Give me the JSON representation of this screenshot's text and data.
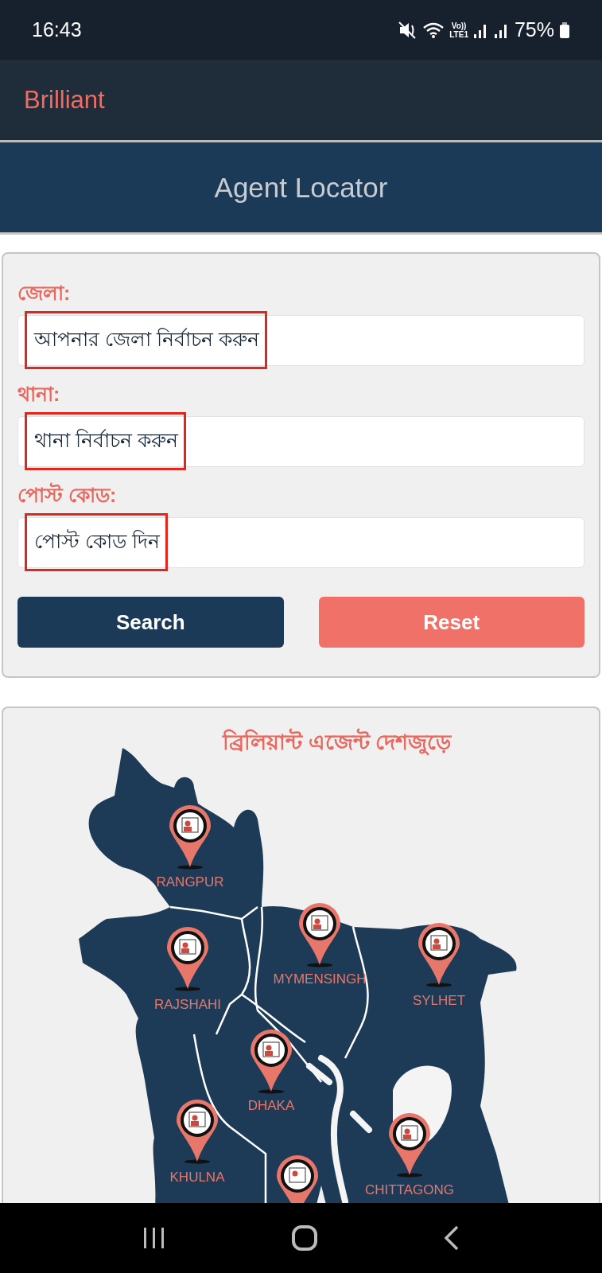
{
  "status_bar": {
    "time": "16:43",
    "volte": [
      "Vo))",
      "LTE1"
    ],
    "battery": "75%"
  },
  "app_bar": {
    "title": "Brilliant"
  },
  "banner": {
    "title": "Agent Locator"
  },
  "form": {
    "fields": [
      {
        "label": "জেলা:",
        "placeholder": "আপনার জেলা নির্বাচন করুন",
        "highlighted": true
      },
      {
        "label": "থানা:",
        "placeholder": "থানা নির্বাচন করুন",
        "highlighted": true
      },
      {
        "label": "পোস্ট কোড:",
        "placeholder": "পোস্ট কোড দিন",
        "highlighted": true
      }
    ],
    "buttons": [
      {
        "label": "Search",
        "kind": "primary"
      },
      {
        "label": "Reset",
        "kind": "secondary"
      }
    ]
  },
  "map": {
    "title": "ব্রিলিয়ান্ট এজেন্ট দেশজুড়ে",
    "divisions": [
      {
        "name": "RANGPUR"
      },
      {
        "name": "RAJSHAHI"
      },
      {
        "name": "MYMENSINGH"
      },
      {
        "name": "SYLHET"
      },
      {
        "name": "DHAKA"
      },
      {
        "name": "KHULNA"
      },
      {
        "name": "CHITTAGONG"
      }
    ]
  }
}
